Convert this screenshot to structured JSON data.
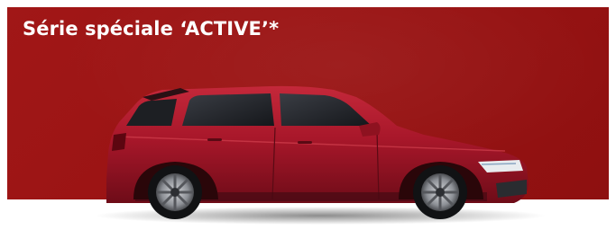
{
  "banner": {
    "title": "Série spéciale ‘ACTIVE’*",
    "background_color": "#991313",
    "car_color": "#b01c26",
    "car_image": "red-hatchback-car"
  }
}
